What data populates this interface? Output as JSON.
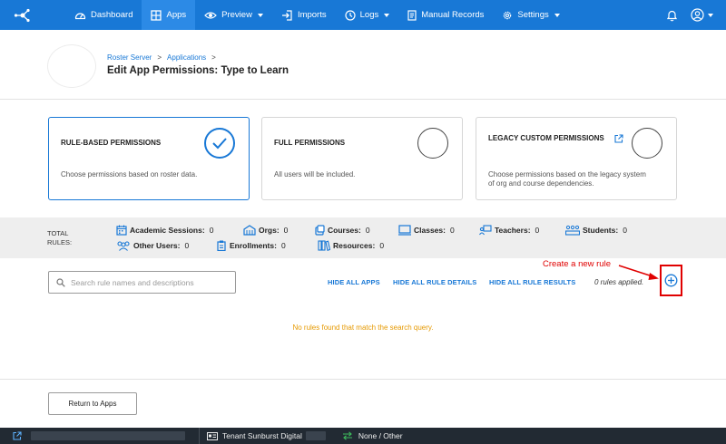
{
  "nav": {
    "items": [
      {
        "label": "Dashboard",
        "icon": "dashboard-icon",
        "active": false,
        "dropdown": false
      },
      {
        "label": "Apps",
        "icon": "apps-icon",
        "active": true,
        "dropdown": false
      },
      {
        "label": "Preview",
        "icon": "eye-icon",
        "active": false,
        "dropdown": true
      },
      {
        "label": "Imports",
        "icon": "import-icon",
        "active": false,
        "dropdown": false
      },
      {
        "label": "Logs",
        "icon": "clock-icon",
        "active": false,
        "dropdown": true
      },
      {
        "label": "Manual Records",
        "icon": "document-icon",
        "active": false,
        "dropdown": false
      },
      {
        "label": "Settings",
        "icon": "gear-icon",
        "active": false,
        "dropdown": true
      }
    ]
  },
  "header": {
    "breadcrumb": [
      "Roster Server",
      "Applications"
    ],
    "breadcrumb_separator": ">",
    "title": "Edit App Permissions: Type to Learn"
  },
  "cards": [
    {
      "title": "RULE-BASED PERMISSIONS",
      "description": "Choose permissions based on roster data.",
      "selected": true
    },
    {
      "title": "FULL PERMISSIONS",
      "description": "All users will be included.",
      "selected": false
    },
    {
      "title": "LEGACY CUSTOM PERMISSIONS",
      "description": "Choose permissions based on the legacy system of org and course dependencies.",
      "selected": false
    }
  ],
  "totals": {
    "label": "TOTAL RULES:",
    "stats": [
      {
        "label": "Academic Sessions:",
        "value": "0",
        "icon": "calendar-icon"
      },
      {
        "label": "Orgs:",
        "value": "0",
        "icon": "building-icon"
      },
      {
        "label": "Courses:",
        "value": "0",
        "icon": "courses-icon"
      },
      {
        "label": "Classes:",
        "value": "0",
        "icon": "classroom-icon"
      },
      {
        "label": "Teachers:",
        "value": "0",
        "icon": "teacher-icon"
      },
      {
        "label": "Students:",
        "value": "0",
        "icon": "students-icon"
      },
      {
        "label": "Other Users:",
        "value": "0",
        "icon": "users-icon"
      },
      {
        "label": "Enrollments:",
        "value": "0",
        "icon": "clipboard-icon"
      },
      {
        "label": "Resources:",
        "value": "0",
        "icon": "books-icon"
      }
    ]
  },
  "toolbar": {
    "search_placeholder": "Search rule names and descriptions",
    "search_value": "",
    "hide_all_apps": "HIDE ALL APPS",
    "hide_all_rule_details": "HIDE ALL RULE DETAILS",
    "hide_all_rule_results": "HIDE ALL RULE RESULTS",
    "rules_applied": "0 rules applied."
  },
  "annotation": {
    "text": "Create a new rule",
    "color": "#e00000"
  },
  "empty_message": "No rules found that match the search query.",
  "return_button": "Return to Apps",
  "statusbar": {
    "tenant_label": "Tenant Sunburst Digital",
    "sync_label": "None / Other"
  },
  "colors": {
    "primary": "#1878d6",
    "warning": "#e69900",
    "annotation": "#e00000",
    "statusbar": "#222a33"
  }
}
